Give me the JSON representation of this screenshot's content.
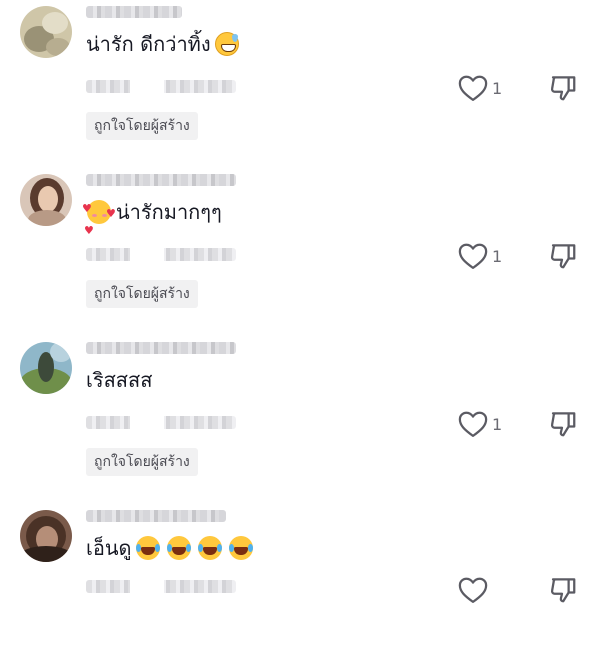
{
  "comments": [
    {
      "text": "น่ารัก ดีกว่าทิ้ง",
      "emoji": "grinning-sweat-emoji",
      "likes": "1",
      "creator_liked": "ถูกใจโดยผู้สร้าง"
    },
    {
      "text": "น่ารักมากๆๆ",
      "emoji": "smiling-hearts-emoji",
      "likes": "1",
      "creator_liked": "ถูกใจโดยผู้สร้าง"
    },
    {
      "text": "เริสสสส",
      "likes": "1",
      "creator_liked": "ถูกใจโดยผู้สร้าง"
    },
    {
      "text": "เอ็นดู",
      "emoji": "tears-of-joy-emoji",
      "emoji_count": 4,
      "likes": ""
    }
  ],
  "icons": {
    "like": "heart-outline-icon",
    "dislike": "thumbs-down-icon"
  },
  "colors": {
    "text": "#161823",
    "icon": "#5b5b63",
    "badge_bg": "#f1f1f2"
  }
}
